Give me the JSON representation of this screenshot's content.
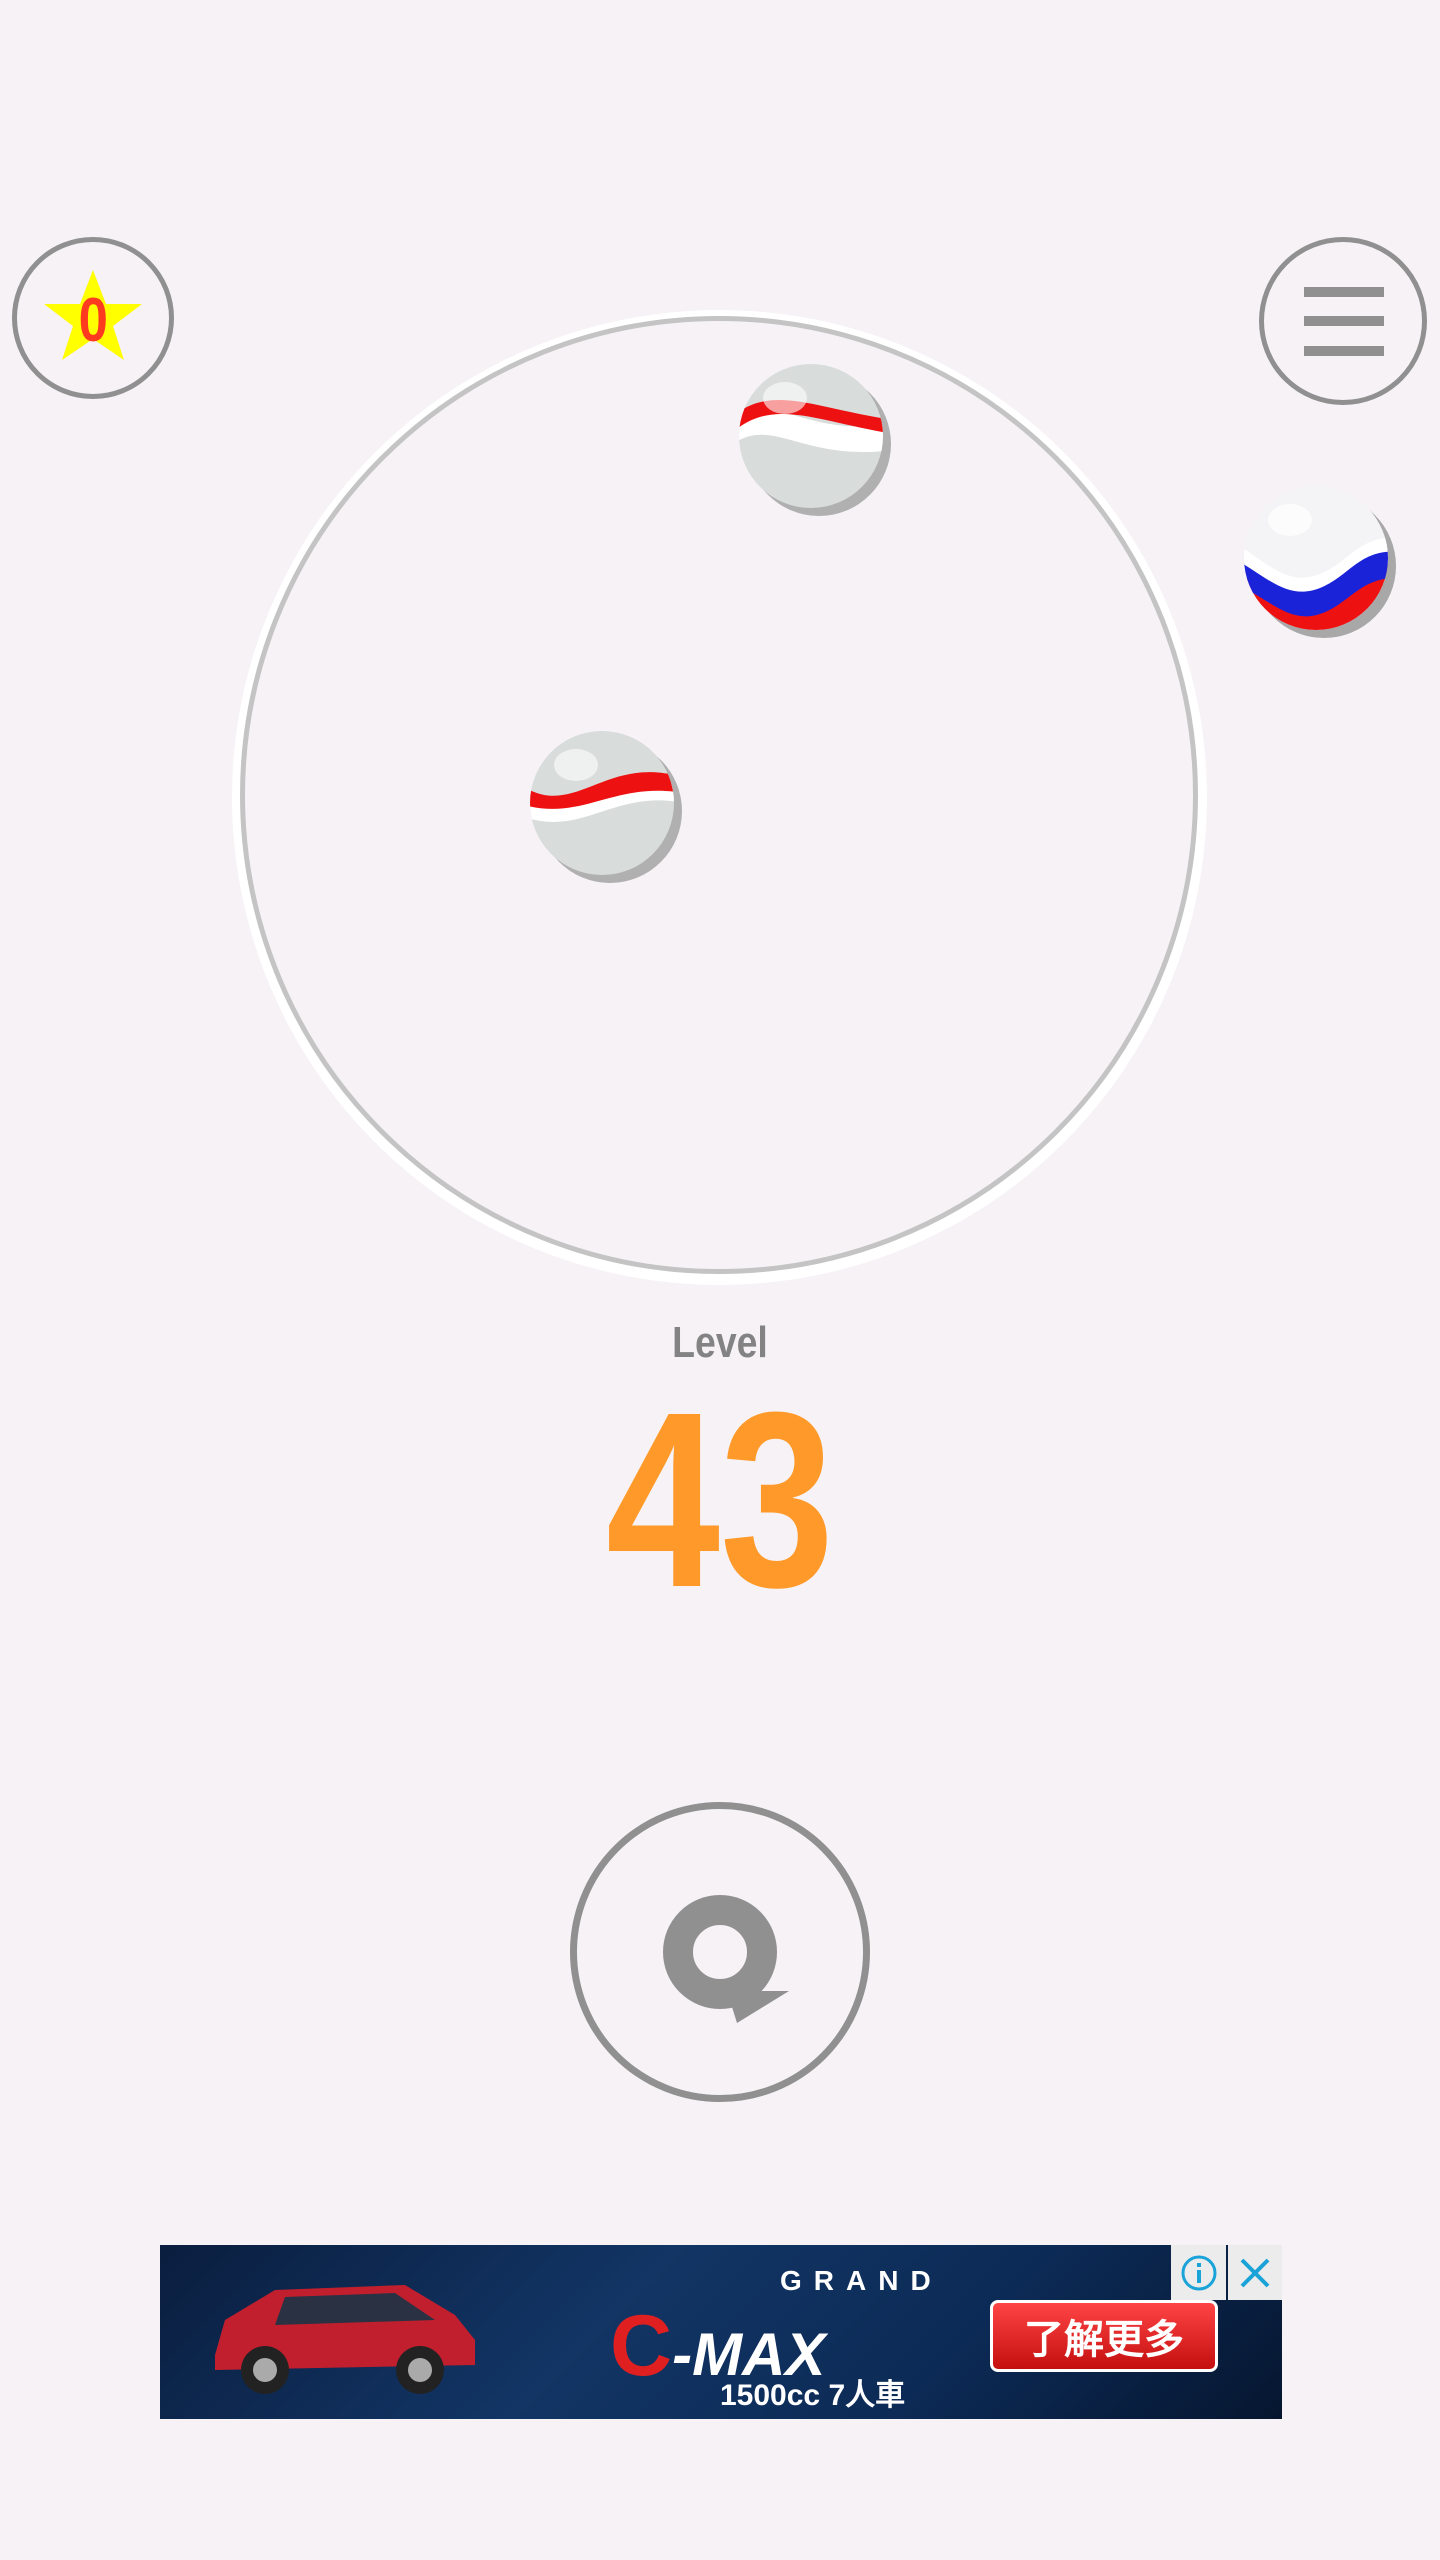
{
  "header": {
    "star_count": "0",
    "star_icon": "star-icon",
    "menu_icon": "hamburger-menu-icon"
  },
  "game": {
    "level_label": "Level",
    "level_number": "43",
    "restart_icon": "restart-icon"
  },
  "colors": {
    "background": "#f6f2f6",
    "level_number": "#ff9a2a",
    "level_label": "#838383",
    "icon_gray": "#909090",
    "star_fill": "#ffff00",
    "star_count": "#ff3b1f",
    "board_ring": "#c4c4c4"
  },
  "ad": {
    "brand": "GRAND",
    "model": "MAX",
    "subtitle": "1500cc 7人車",
    "cta": "了解更多",
    "info_icon": "info-icon",
    "close_icon": "close-icon"
  }
}
